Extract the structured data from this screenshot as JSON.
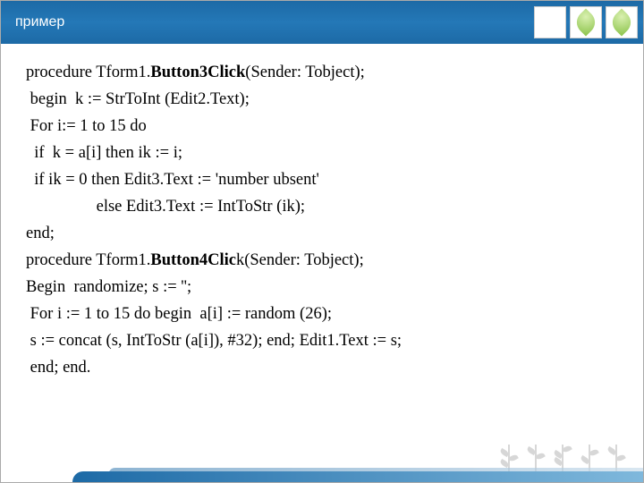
{
  "header": {
    "title": "пример"
  },
  "code": {
    "l1a": "procedure Tform1.",
    "l1b": "Button3Click",
    "l1c": "(Sender: Tobject);",
    "l2": " begin  k := StrToInt (Edit2.Text);",
    "l3": " For i:= 1 to 15 do",
    "l4": "  if  k = a[i] then ik := i;",
    "l5": "  if ik = 0 then Edit3.Text := 'number ubsent'",
    "l6": "                 else Edit3.Text := IntToStr (ik);",
    "l7": "end;",
    "l8a": "procedure Tform1.",
    "l8b": "Button4Clic",
    "l8c": "k(Sender: Tobject);",
    "l9": "Begin  randomize; s := '';",
    "l10": " For i := 1 to 15 do begin  a[i] := random (26);",
    "l11": " s := concat (s, IntToStr (a[i]), #32); end; Edit1.Text := s;",
    "l12": " end; end."
  }
}
